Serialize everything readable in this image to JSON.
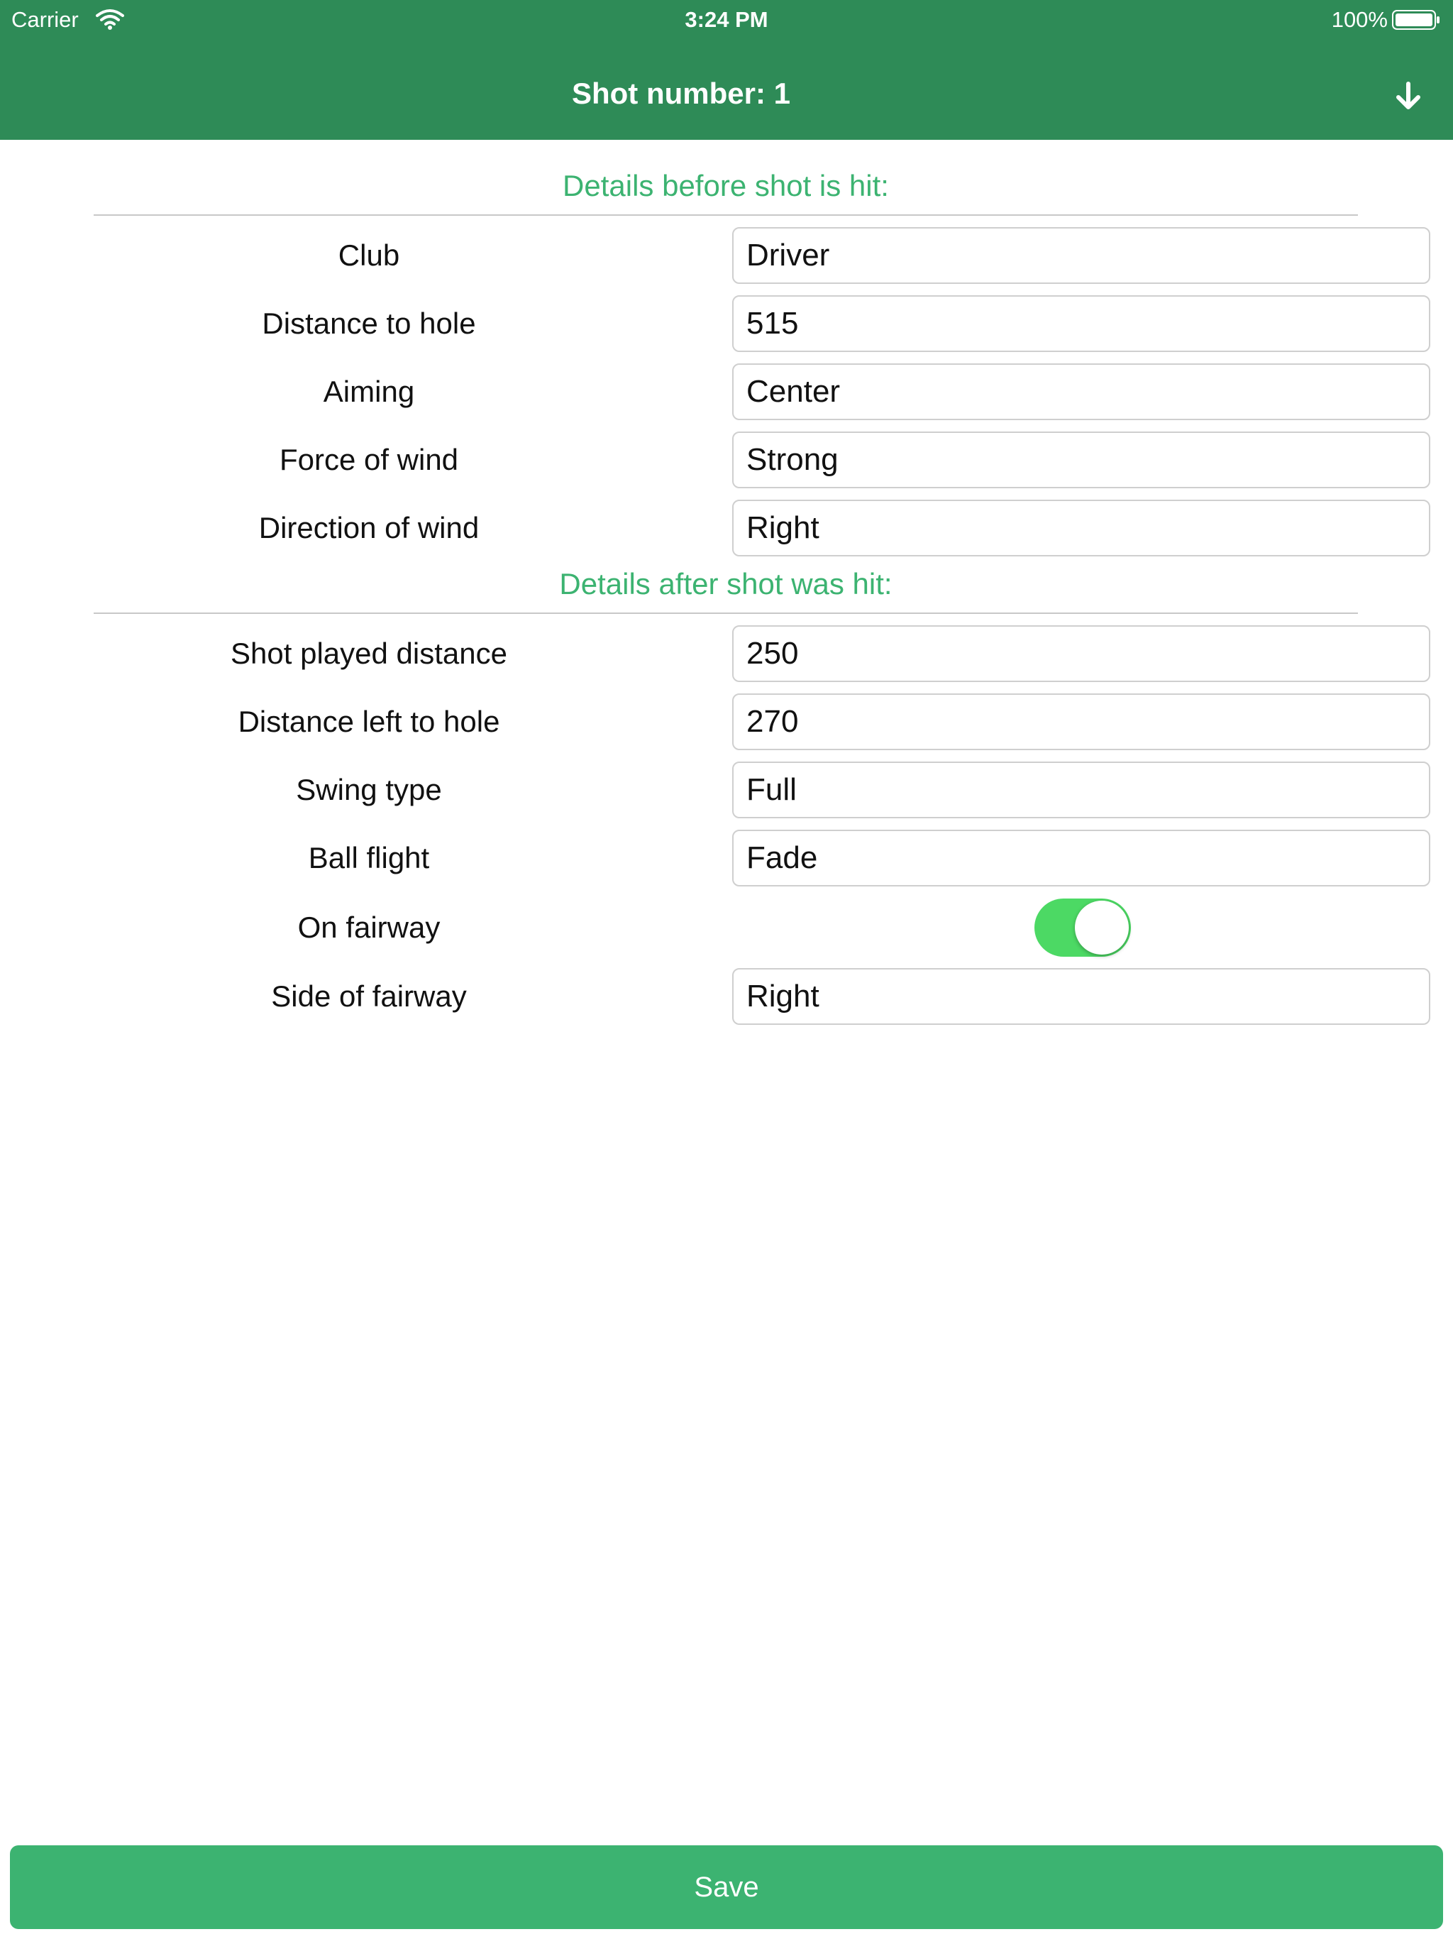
{
  "status_bar": {
    "carrier": "Carrier",
    "time": "3:24 PM",
    "battery_percent": "100%",
    "icons": [
      "wifi-icon",
      "battery-icon"
    ]
  },
  "nav": {
    "title": "Shot number: 1",
    "action_icon": "down-arrow-icon"
  },
  "colors": {
    "header_bg": "#2e8b57",
    "accent": "#3cb371",
    "toggle_on": "#4cd964"
  },
  "before_section": {
    "title": "Details before shot is hit:",
    "rows": [
      {
        "label": "Club",
        "value": "Driver"
      },
      {
        "label": "Distance to hole",
        "value": "515"
      },
      {
        "label": "Aiming",
        "value": "Center"
      },
      {
        "label": "Force of wind",
        "value": "Strong"
      },
      {
        "label": "Direction of wind",
        "value": "Right"
      }
    ]
  },
  "after_section": {
    "title": "Details after shot was hit:",
    "rows": [
      {
        "label": "Shot played distance",
        "value": "250"
      },
      {
        "label": "Distance left to hole",
        "value": "270"
      },
      {
        "label": "Swing type",
        "value": "Full"
      },
      {
        "label": "Ball flight",
        "value": "Fade"
      }
    ],
    "on_fairway": {
      "label": "On fairway",
      "value": true
    },
    "side_of_fairway": {
      "label": "Side of fairway",
      "value": "Right"
    }
  },
  "save_button": {
    "label": "Save"
  }
}
